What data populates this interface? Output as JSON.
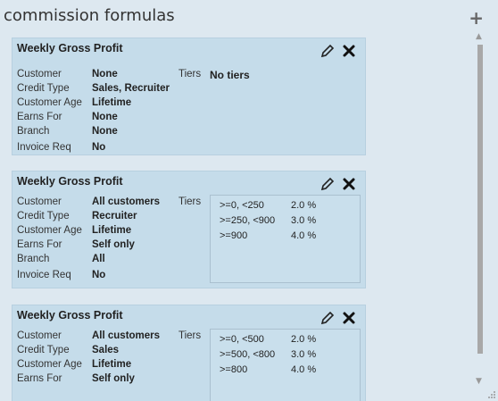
{
  "header": {
    "title": "commission formulas",
    "add_label": "+"
  },
  "labels": {
    "customer": "Customer",
    "credit_type": "Credit Type",
    "customer_age": "Customer Age",
    "earns_for": "Earns For",
    "branch": "Branch",
    "invoice_req": "Invoice Req",
    "tiers": "Tiers"
  },
  "cards": [
    {
      "title": "Weekly Gross Profit",
      "customer": "None",
      "credit_type": "Sales, Recruiter",
      "customer_age": "Lifetime",
      "earns_for": "None",
      "branch": "None",
      "invoice_req": "No",
      "tiers_text": "No tiers"
    },
    {
      "title": "Weekly Gross Profit",
      "customer": "All customers",
      "credit_type": "Recruiter",
      "customer_age": "Lifetime",
      "earns_for": "Self only",
      "branch": "All",
      "invoice_req": "No",
      "tiers": [
        {
          "range": ">=0,  <250",
          "rate": "2.0 %"
        },
        {
          "range": ">=250,  <900",
          "rate": "3.0 %"
        },
        {
          "range": ">=900",
          "rate": "4.0 %"
        }
      ]
    },
    {
      "title": "Weekly Gross Profit",
      "customer": "All customers",
      "credit_type": "Sales",
      "customer_age": "Lifetime",
      "earns_for": "Self only",
      "tiers": [
        {
          "range": ">=0,  <500",
          "rate": "2.0 %"
        },
        {
          "range": ">=500,  <800",
          "rate": "3.0 %"
        },
        {
          "range": ">=800",
          "rate": "4.0 %"
        }
      ]
    }
  ],
  "icons": {
    "edit": "pencil-icon",
    "delete": "close-icon"
  }
}
